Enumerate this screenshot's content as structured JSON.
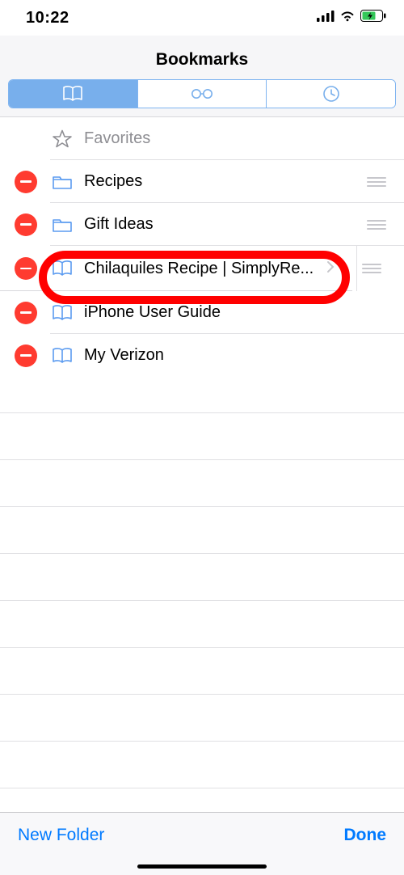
{
  "status": {
    "time": "10:22"
  },
  "nav": {
    "title": "Bookmarks"
  },
  "rows": {
    "favorites": "Favorites",
    "recipes": "Recipes",
    "gift_ideas": "Gift Ideas",
    "chilaquiles": "Chilaquiles Recipe | SimplyRe...",
    "iphone_guide": "iPhone User Guide",
    "my_verizon": "My Verizon"
  },
  "toolbar": {
    "new_folder": "New Folder",
    "done": "Done"
  },
  "colors": {
    "accent": "#007aff",
    "segment_active": "#78afec",
    "delete": "#ff3b30",
    "icon_blue": "#4a90e2",
    "gray": "#8e8e93",
    "highlight": "#ff0000"
  }
}
